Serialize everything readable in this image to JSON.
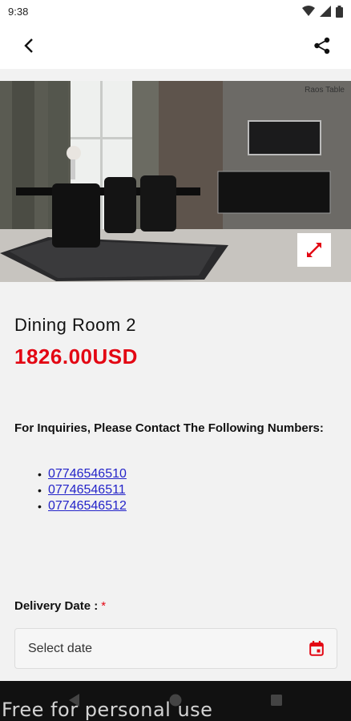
{
  "status_bar": {
    "time": "9:38"
  },
  "app_bar": {
    "back_icon": "arrow-back-icon",
    "share_icon": "share-icon"
  },
  "hero": {
    "caption": "Raos Table",
    "expand_icon": "expand-icon"
  },
  "product": {
    "title": "Dining Room 2",
    "price": "1826.00USD"
  },
  "inquiry": {
    "text": "For Inquiries, Please Contact The Following Numbers:",
    "phones": [
      "07746546510",
      "07746546511",
      "07746546512"
    ]
  },
  "delivery": {
    "label": "Delivery Date :",
    "required_mark": "*",
    "placeholder": "Select date",
    "calendar_icon": "calendar-icon"
  },
  "watermark": "Free for personal use",
  "colors": {
    "accent": "#e30613",
    "link": "#2424c9"
  }
}
